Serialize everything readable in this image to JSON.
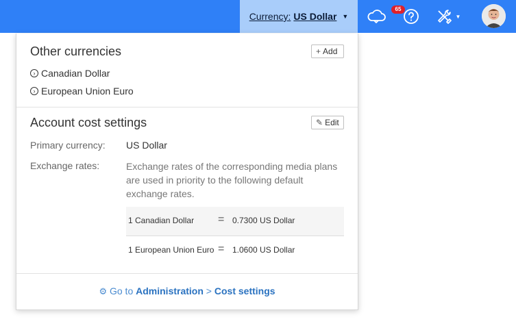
{
  "topbar": {
    "currency_label": "Currency:",
    "currency_value": "US Dollar",
    "notification_count": "65",
    "icons": [
      "cloud-bell-icon",
      "help-icon",
      "tools-icon",
      "avatar"
    ],
    "background_color": "#2f80f7",
    "currency_bg_color": "#a9cdfa"
  },
  "other_currencies": {
    "title": "Other currencies",
    "add_label": "Add",
    "items": [
      {
        "label": "Canadian Dollar"
      },
      {
        "label": "European Union Euro"
      }
    ]
  },
  "account_cost": {
    "title": "Account cost settings",
    "edit_label": "Edit",
    "primary_label": "Primary currency:",
    "primary_value": "US Dollar",
    "rates_label": "Exchange rates:",
    "rates_description": "Exchange rates of the corresponding media plans are used in priority to the following default exchange rates.",
    "rates": [
      {
        "from": "1 Canadian Dollar",
        "eq": "=",
        "to": "0.7300 US Dollar"
      },
      {
        "from": "1 European Union Euro",
        "eq": "=",
        "to": "1.0600 US Dollar"
      }
    ]
  },
  "footer": {
    "prefix": "Go to",
    "admin_link": "Administration",
    "separator": ">",
    "cost_link": "Cost settings"
  }
}
